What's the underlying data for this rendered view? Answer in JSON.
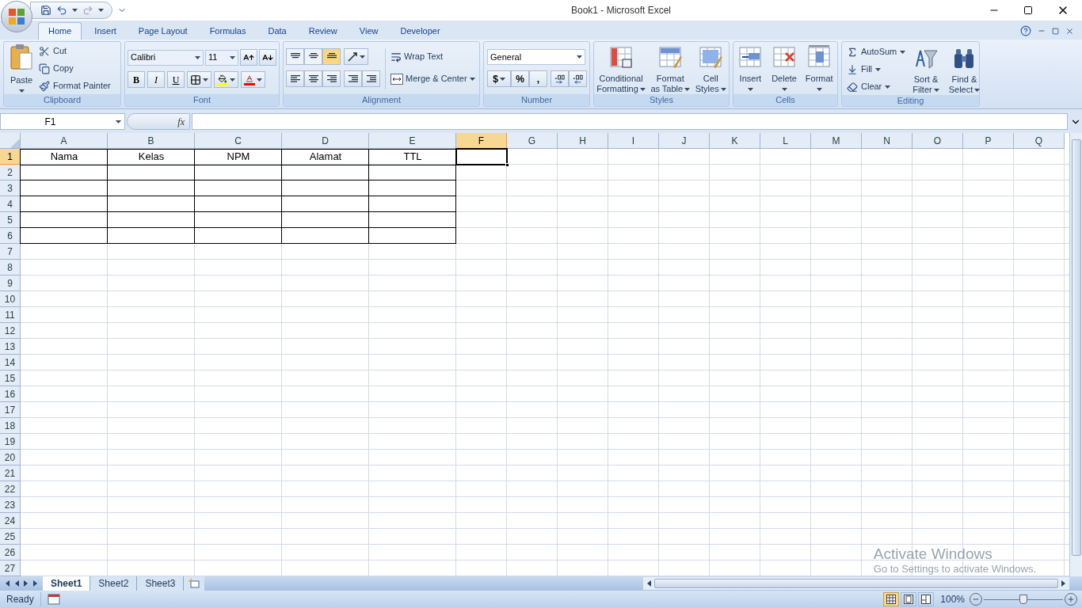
{
  "window": {
    "title": "Book1 - Microsoft Excel"
  },
  "ribbon_tabs": [
    {
      "label": "Home",
      "selected": true
    },
    {
      "label": "Insert",
      "selected": false
    },
    {
      "label": "Page Layout",
      "selected": false
    },
    {
      "label": "Formulas",
      "selected": false
    },
    {
      "label": "Data",
      "selected": false
    },
    {
      "label": "Review",
      "selected": false
    },
    {
      "label": "View",
      "selected": false
    },
    {
      "label": "Developer",
      "selected": false
    }
  ],
  "ribbon_groups": [
    {
      "kind": "clipboard",
      "label": "Clipboard",
      "paste": "Paste",
      "items": [
        "Cut",
        "Copy",
        "Format Painter"
      ]
    },
    {
      "kind": "font",
      "label": "Font",
      "font_name": "Calibri",
      "font_size": "11",
      "styles": [
        "B",
        "I",
        "U"
      ]
    },
    {
      "kind": "alignment",
      "label": "Alignment",
      "vertical": [
        {
          "selected": false
        },
        {
          "selected": false
        },
        {
          "selected": true
        }
      ],
      "items": [
        "Wrap Text",
        "Merge & Center"
      ]
    },
    {
      "kind": "number",
      "label": "Number",
      "format": "General",
      "symbols": [
        "$",
        "%",
        ","
      ]
    },
    {
      "kind": "large",
      "label": "Styles",
      "buttons": [
        {
          "lines": [
            "Conditional",
            "Formatting"
          ]
        },
        {
          "lines": [
            "Format",
            "as Table"
          ]
        },
        {
          "lines": [
            "Cell",
            "Styles"
          ]
        }
      ]
    },
    {
      "kind": "large",
      "label": "Cells",
      "buttons": [
        {
          "lines": [
            "Insert"
          ]
        },
        {
          "lines": [
            "Delete"
          ]
        },
        {
          "lines": [
            "Format"
          ]
        }
      ]
    },
    {
      "kind": "editing",
      "label": "Editing",
      "items": [
        "AutoSum",
        "Fill",
        "Clear"
      ],
      "buttons": [
        {
          "lines": [
            "Sort &",
            "Filter"
          ]
        },
        {
          "lines": [
            "Find &",
            "Select"
          ]
        }
      ]
    }
  ],
  "formula_bar": {
    "name_box": "F1",
    "function_label": "fx"
  },
  "sheet": {
    "columns": [
      {
        "label": "A",
        "selected": false
      },
      {
        "label": "B",
        "selected": false
      },
      {
        "label": "C",
        "selected": false
      },
      {
        "label": "D",
        "selected": false
      },
      {
        "label": "E",
        "selected": false
      },
      {
        "label": "F",
        "selected": true
      },
      {
        "label": "G",
        "selected": false
      },
      {
        "label": "H",
        "selected": false
      },
      {
        "label": "I",
        "selected": false
      },
      {
        "label": "J",
        "selected": false
      },
      {
        "label": "K",
        "selected": false
      },
      {
        "label": "L",
        "selected": false
      },
      {
        "label": "M",
        "selected": false
      },
      {
        "label": "N",
        "selected": false
      },
      {
        "label": "O",
        "selected": false
      },
      {
        "label": "P",
        "selected": false
      },
      {
        "label": "Q",
        "selected": false
      }
    ],
    "rows": [
      {
        "label": "1",
        "selected": true,
        "bordered": true,
        "cells": [
          "Nama",
          "Kelas",
          "NPM",
          "Alamat",
          "TTL"
        ]
      },
      {
        "label": "2",
        "selected": false,
        "bordered": true
      },
      {
        "label": "3",
        "selected": false,
        "bordered": true
      },
      {
        "label": "4",
        "selected": false,
        "bordered": true
      },
      {
        "label": "5",
        "selected": false,
        "bordered": true
      },
      {
        "label": "6",
        "selected": false,
        "bordered": true
      },
      {
        "label": "7",
        "selected": false,
        "bordered": false
      },
      {
        "label": "8",
        "selected": false,
        "bordered": false
      },
      {
        "label": "9",
        "selected": false,
        "bordered": false
      },
      {
        "label": "10",
        "selected": false,
        "bordered": false
      },
      {
        "label": "11",
        "selected": false,
        "bordered": false
      },
      {
        "label": "12",
        "selected": false,
        "bordered": false
      },
      {
        "label": "13",
        "selected": false,
        "bordered": false
      },
      {
        "label": "14",
        "selected": false,
        "bordered": false
      },
      {
        "label": "15",
        "selected": false,
        "bordered": false
      },
      {
        "label": "16",
        "selected": false,
        "bordered": false
      },
      {
        "label": "17",
        "selected": false,
        "bordered": false
      },
      {
        "label": "18",
        "selected": false,
        "bordered": false
      },
      {
        "label": "19",
        "selected": false,
        "bordered": false
      },
      {
        "label": "20",
        "selected": false,
        "bordered": false
      },
      {
        "label": "21",
        "selected": false,
        "bordered": false
      },
      {
        "label": "22",
        "selected": false,
        "bordered": false
      },
      {
        "label": "23",
        "selected": false,
        "bordered": false
      },
      {
        "label": "24",
        "selected": false,
        "bordered": false
      },
      {
        "label": "25",
        "selected": false,
        "bordered": false
      },
      {
        "label": "26",
        "selected": false,
        "bordered": false
      },
      {
        "label": "27",
        "selected": false,
        "bordered": false
      }
    ]
  },
  "sheet_tabs": [
    {
      "label": "Sheet1",
      "selected": true
    },
    {
      "label": "Sheet2",
      "selected": false
    },
    {
      "label": "Sheet3",
      "selected": false
    }
  ],
  "status_bar": {
    "text": "Ready",
    "views": [
      {
        "selected": true
      },
      {
        "selected": false
      },
      {
        "selected": false
      }
    ],
    "zoom": "100%",
    "zoom_slider": {
      "level": 0.5
    }
  },
  "activation_notice": {
    "title": "Activate Windows",
    "subtitle": "Go to Settings to activate Windows."
  }
}
